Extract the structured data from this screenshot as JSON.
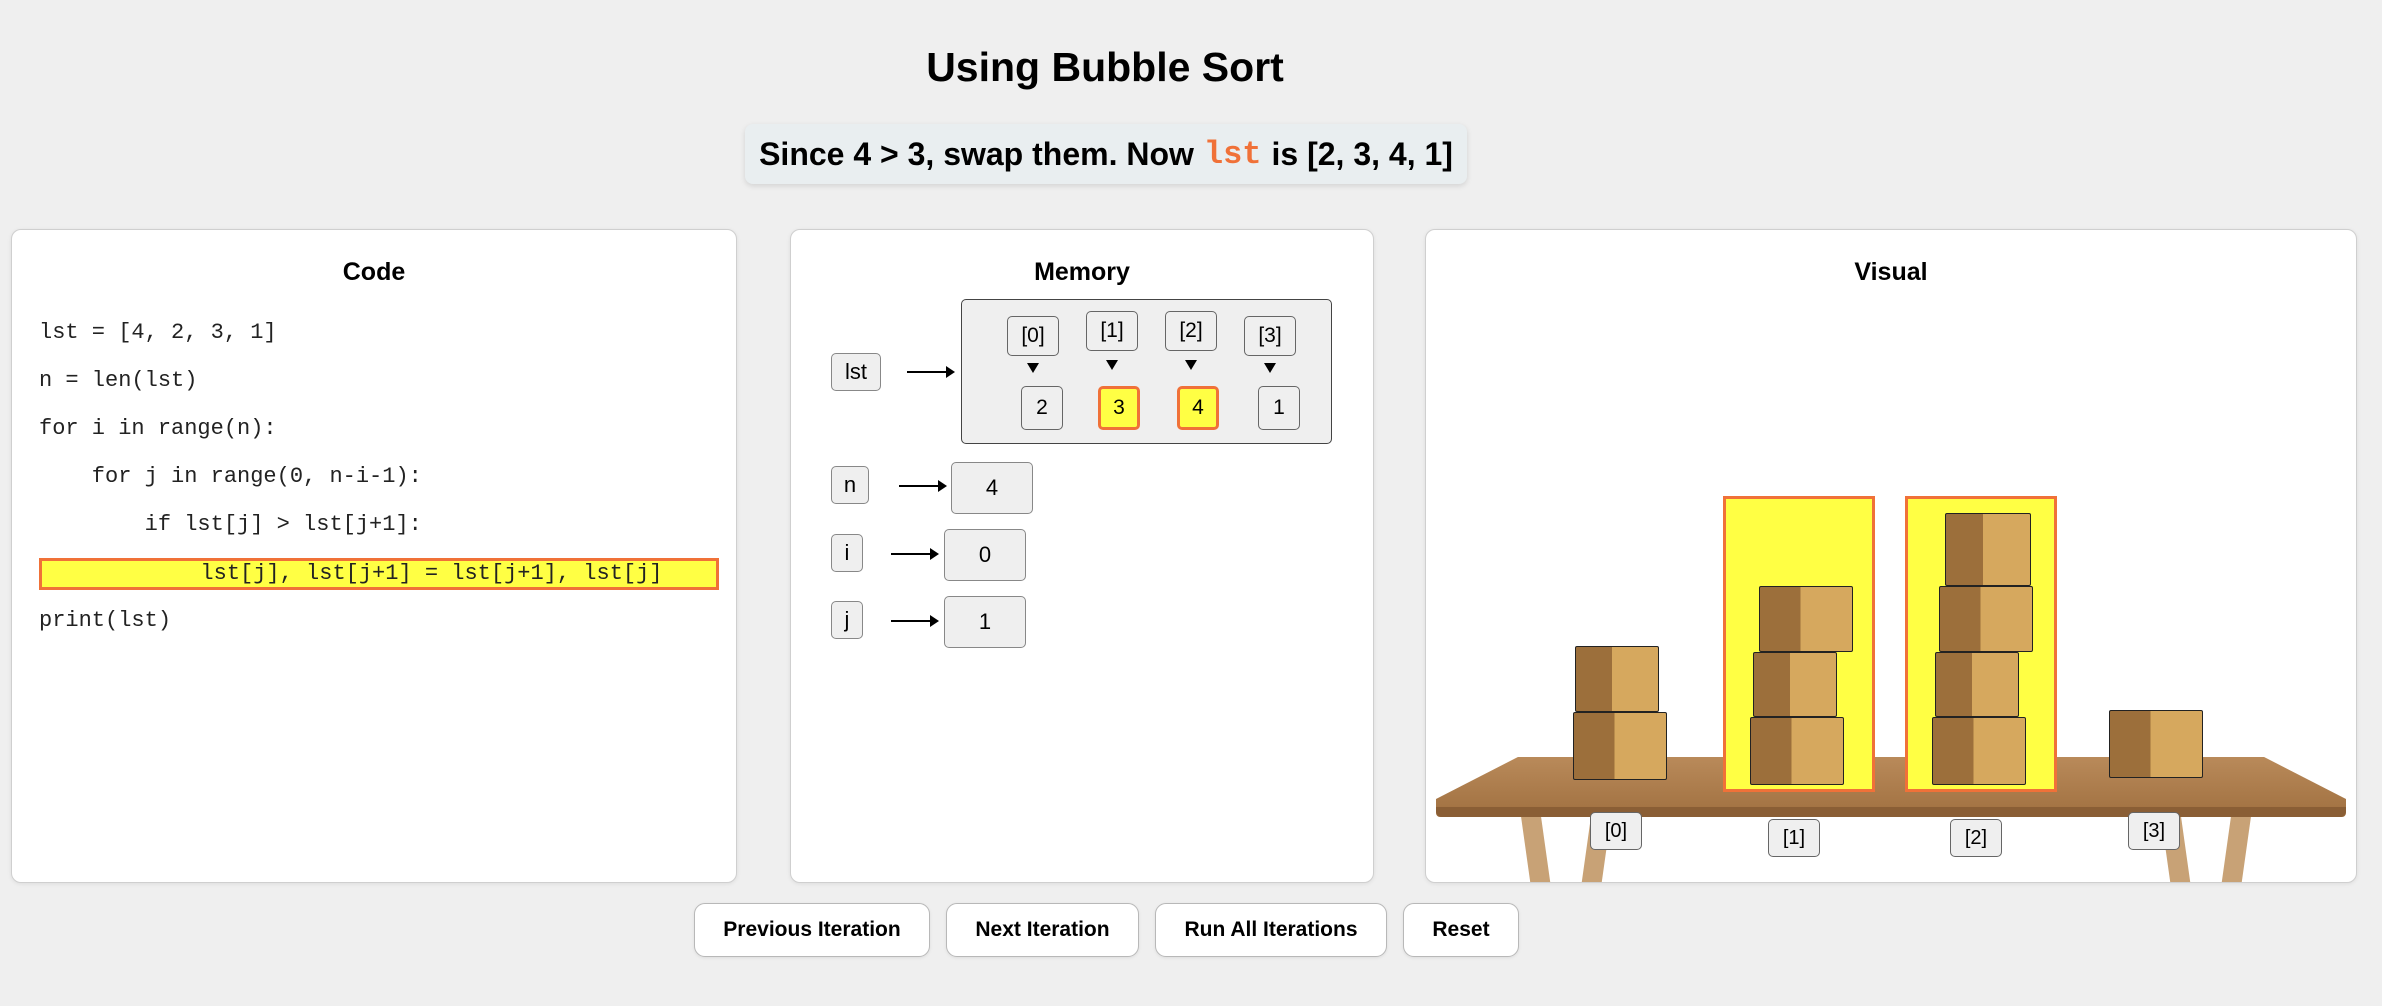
{
  "title": "Using Bubble Sort",
  "explanation": {
    "prefix": "Since 4 > 3, swap them. Now",
    "code_word": "lst",
    "suffix": "is [2, 3, 4, 1]"
  },
  "code_panel": {
    "title": "Code",
    "lines": [
      "lst = [4, 2, 3, 1]",
      "n = len(lst)",
      "for i in range(n):",
      "    for j in range(0, n-i-1):",
      "        if lst[j] > lst[j+1]:",
      "            lst[j], lst[j+1] = lst[j+1], lst[j]",
      "print(lst)"
    ],
    "active_line_index": 5
  },
  "memory_panel": {
    "title": "Memory",
    "list_name": "lst",
    "indices": [
      "[0]",
      "[1]",
      "[2]",
      "[3]"
    ],
    "values": [
      "2",
      "3",
      "4",
      "1"
    ],
    "highlighted_cells": [
      1,
      2
    ],
    "vars": [
      {
        "name": "n",
        "value": "4"
      },
      {
        "name": "i",
        "value": "0"
      },
      {
        "name": "j",
        "value": "1"
      }
    ]
  },
  "visual_panel": {
    "title": "Visual",
    "labels": [
      "[0]",
      "[1]",
      "[2]",
      "[3]"
    ],
    "box_counts": [
      2,
      3,
      4,
      1
    ],
    "highlighted_slots": [
      1,
      2
    ]
  },
  "buttons": {
    "previous": "Previous Iteration",
    "next": "Next Iteration",
    "run_all": "Run All Iterations",
    "reset": "Reset"
  },
  "colors": {
    "highlight_fill": "#ffff44",
    "highlight_border": "#f07138",
    "code_word": "#f07138"
  }
}
